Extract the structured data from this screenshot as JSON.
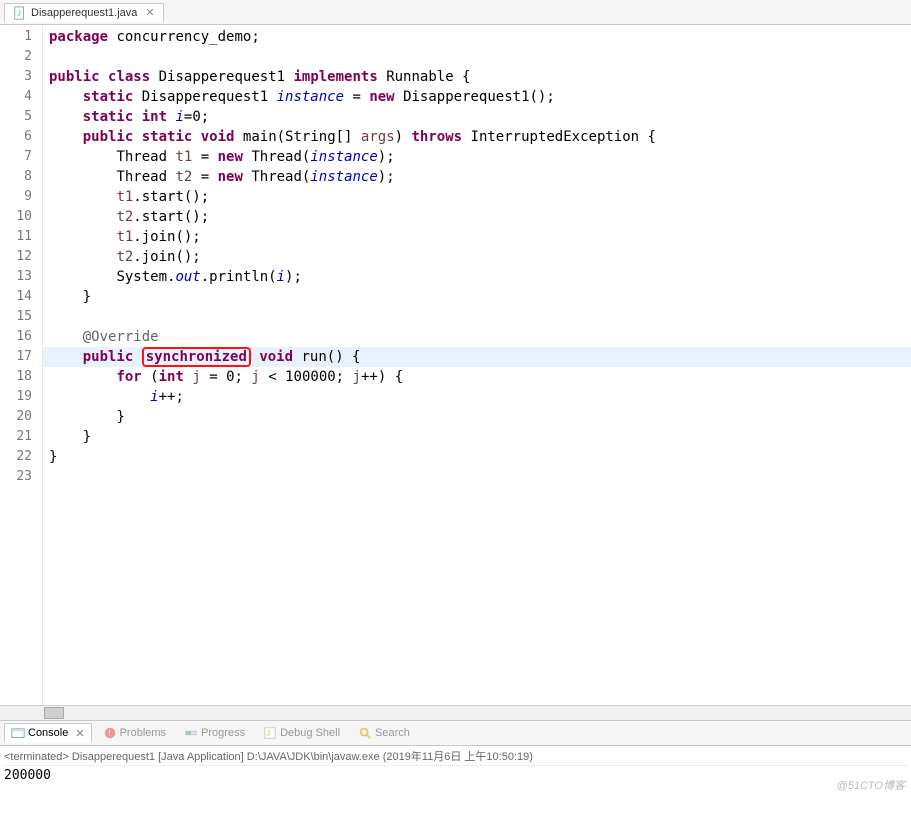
{
  "tab": {
    "filename": "Disapperequest1.java"
  },
  "editor": {
    "highlight_line": 17,
    "lines": [
      {
        "n": 1,
        "html": "<span class='kw'>package</span> <span class='text'>concurrency_demo;</span>"
      },
      {
        "n": 2,
        "html": ""
      },
      {
        "n": 3,
        "html": "<span class='kw'>public</span> <span class='kw'>class</span> <span class='text'>Disapperequest1 </span><span class='kw'>implements</span> <span class='text'>Runnable {</span>"
      },
      {
        "n": 4,
        "html": "    <span class='kw'>static</span> <span class='text'>Disapperequest1 </span><span class='static-field'>instance</span> <span class='text'>= </span><span class='kw'>new</span> <span class='text'>Disapperequest1();</span>"
      },
      {
        "n": 5,
        "html": "    <span class='kw'>static</span> <span class='kw'>int</span> <span class='static-field'>i</span><span class='text'>=0;</span>"
      },
      {
        "n": 6,
        "fold": true,
        "html": "    <span class='kw'>public</span> <span class='kw'>static</span> <span class='kw'>void</span> <span class='text'>main(String[] </span><span class='param'>args</span><span class='text'>) </span><span class='kw'>throws</span> <span class='text'>InterruptedException {</span>"
      },
      {
        "n": 7,
        "html": "        <span class='text'>Thread </span><span class='param'>t1</span> <span class='text'>= </span><span class='kw'>new</span> <span class='text'>Thread(</span><span class='static-field'>instance</span><span class='text'>);</span>"
      },
      {
        "n": 8,
        "html": "        <span class='text'>Thread </span><span class='param'>t2</span> <span class='text'>= </span><span class='kw'>new</span> <span class='text'>Thread(</span><span class='static-field'>instance</span><span class='text'>);</span>"
      },
      {
        "n": 9,
        "html": "        <span class='param'>t1</span><span class='text'>.start();</span>"
      },
      {
        "n": 10,
        "html": "        <span class='param'>t2</span><span class='text'>.start();</span>"
      },
      {
        "n": 11,
        "html": "        <span class='param'>t1</span><span class='text'>.join();</span>"
      },
      {
        "n": 12,
        "html": "        <span class='param'>t2</span><span class='text'>.join();</span>"
      },
      {
        "n": 13,
        "html": "        <span class='text'>System.</span><span class='static-field'>out</span><span class='text'>.println(</span><span class='static-field'>i</span><span class='text'>);</span>"
      },
      {
        "n": 14,
        "html": "    <span class='text'>}</span>"
      },
      {
        "n": 15,
        "html": ""
      },
      {
        "n": 16,
        "fold": true,
        "html": "    <span class='anno'>@Override</span>"
      },
      {
        "n": 17,
        "html": "    <span class='kw'>public</span> <span class='redbox'><span class='kw'>synchronized</span></span> <span class='kw'>void</span> <span class='text'>run() {</span>"
      },
      {
        "n": 18,
        "html": "        <span class='kw'>for</span> <span class='text'>(</span><span class='kw'>int</span> <span class='param'>j</span> <span class='text'>= 0; </span><span class='param'>j</span> <span class='text'>&lt; 100000; </span><span class='param'>j</span><span class='text'>++) {</span>"
      },
      {
        "n": 19,
        "html": "            <span class='static-field'>i</span><span class='text'>++;</span>"
      },
      {
        "n": 20,
        "html": "        <span class='text'>}</span>"
      },
      {
        "n": 21,
        "html": "    <span class='text'>}</span>"
      },
      {
        "n": 22,
        "html": "<span class='text'>}</span>"
      },
      {
        "n": 23,
        "html": ""
      }
    ]
  },
  "bottom_tabs": {
    "console": "Console",
    "problems": "Problems",
    "progress": "Progress",
    "debug_shell": "Debug Shell",
    "search": "Search"
  },
  "console": {
    "header": "<terminated> Disapperequest1 [Java Application] D:\\JAVA\\JDK\\bin\\javaw.exe (2019年11月6日 上午10:50:19)",
    "output": "200000"
  },
  "watermark": "@51CTO博客"
}
